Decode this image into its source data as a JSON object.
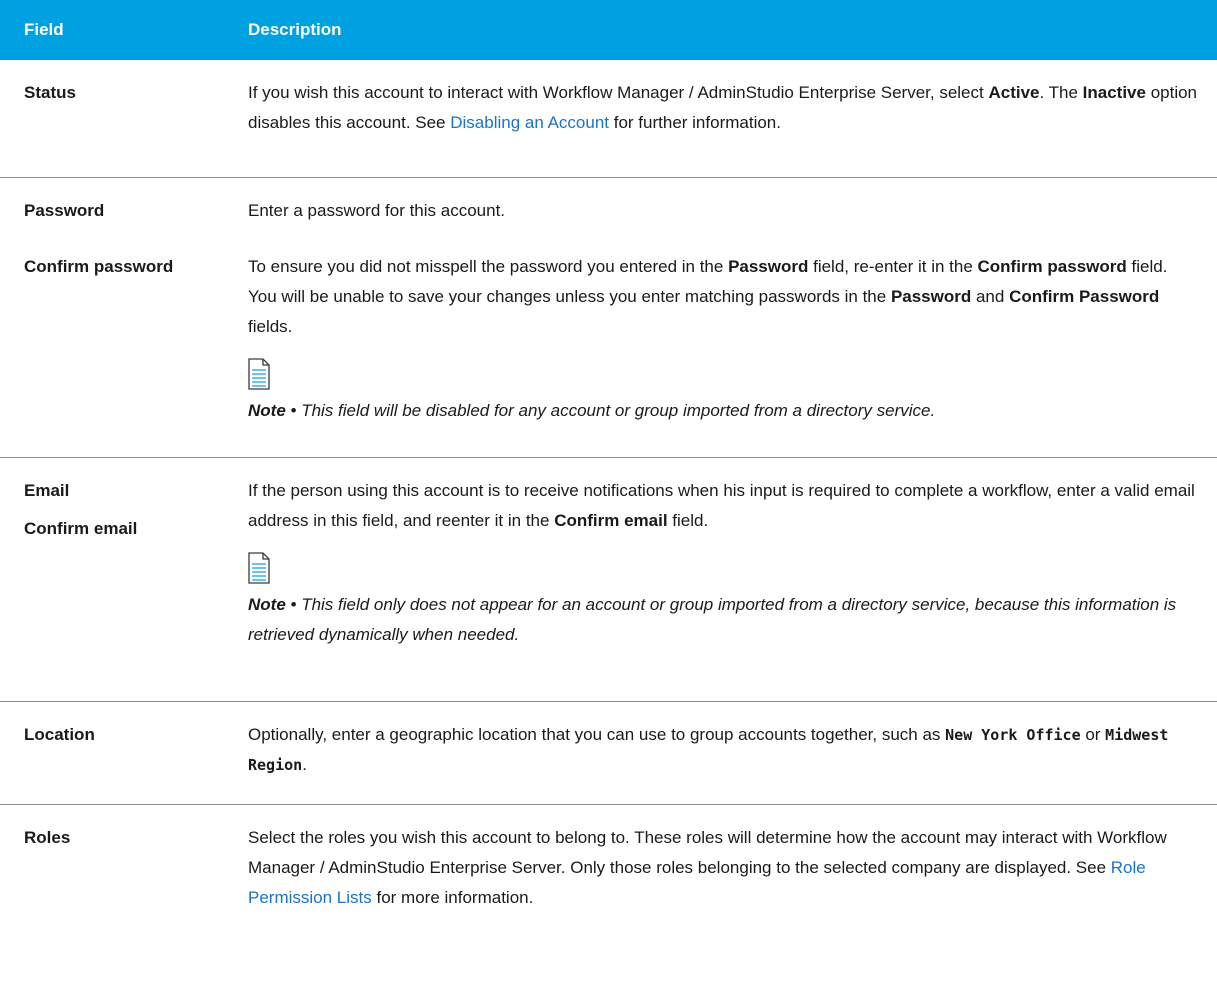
{
  "header": {
    "field": "Field",
    "description": "Description"
  },
  "rows": [
    {
      "fields": [
        "Status"
      ],
      "desc": {
        "t1": "If you wish this account to interact with Workflow Manager / AdminStudio Enterprise Server, select ",
        "b1": "Active",
        "t2": ". The ",
        "b2": "Inactive",
        "t3": " option disables this account. See ",
        "link": "Disabling an Account",
        "t4": " for further information."
      }
    },
    {
      "fields": [
        "Password",
        "Confirm password"
      ],
      "desc": {
        "p1": "Enter a password for this account.",
        "t1": "To ensure you did not misspell the password you entered in the ",
        "b1": "Password",
        "t2": " field, re-enter it in the ",
        "b2": "Confirm password",
        "t3": " field. You will be unable to save your changes unless you enter matching passwords in the ",
        "b3": "Password",
        "t4": " and ",
        "b4": "Confirm Password",
        "t5": " fields.",
        "note_label": "Note",
        "note_sep": " • ",
        "note_text": "This field will be disabled for any account or group imported from a directory service."
      }
    },
    {
      "fields": [
        "Email",
        "Confirm email"
      ],
      "desc": {
        "t1": "If the person using this account is to receive notifications when his input is required to complete a workflow, enter a valid email address in this field, and reenter it in the ",
        "b1": "Confirm email",
        "t2": " field.",
        "note_label": "Note",
        "note_sep": " • ",
        "note_text": "This field only does not appear for an account or group imported from a directory service, because this information is retrieved dynamically when needed."
      }
    },
    {
      "fields": [
        "Location"
      ],
      "desc": {
        "t1": "Optionally, enter a geographic location that you can use to group accounts together, such as ",
        "m1": "New York Office",
        "t2": " or ",
        "m2": "Midwest Region",
        "t3": "."
      }
    },
    {
      "fields": [
        "Roles"
      ],
      "desc": {
        "t1": "Select the roles you wish this account to belong to. These roles will determine how the account may interact with Workflow Manager / AdminStudio Enterprise Server. Only those roles belonging to the selected company are displayed. See ",
        "link": "Role Permission Lists",
        "t2": " for more information."
      }
    }
  ],
  "colors": {
    "header_bg": "#00a1e0",
    "link": "#1a73c9",
    "divider": "#8c8c8c"
  },
  "icons": {
    "note": "note-document-icon"
  }
}
